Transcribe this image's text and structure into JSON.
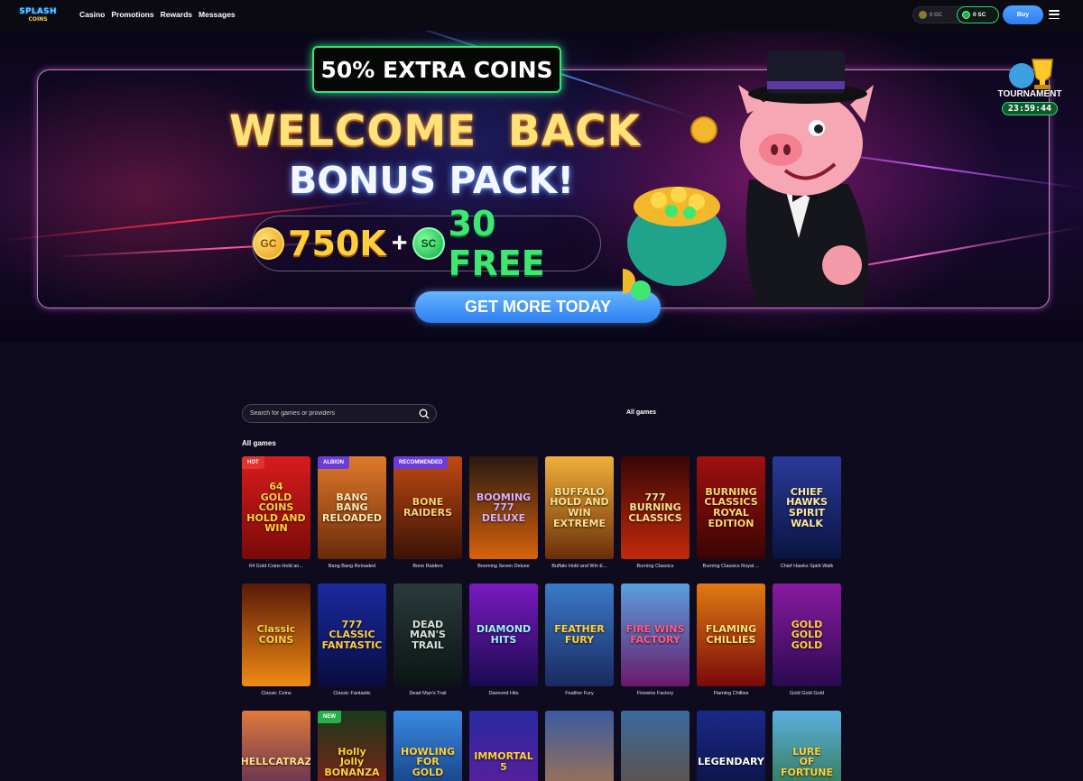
{
  "brand": {
    "line1": "SPLASH",
    "line2": "COINS"
  },
  "nav": [
    "Casino",
    "Promotions",
    "Rewards",
    "Messages"
  ],
  "wallet": {
    "gc": "0 GC",
    "sc": "0 SC",
    "buy": "Buy"
  },
  "banner": {
    "badge": "50% EXTRA COINS",
    "headline": "WELCOME  BACK",
    "subheadline": "BONUS PACK!",
    "gc_coin": "GC",
    "gc_amount": "750K",
    "plus": "+",
    "sc_coin": "SC",
    "sc_amount": "30 FREE",
    "cta": "GET MORE TODAY",
    "tournament_label": "TOURNAMENT",
    "tournament_timer": "23:59:44"
  },
  "search": {
    "placeholder": "Search for games or providers"
  },
  "filter_label": "All games",
  "section_title": "All games",
  "games": [
    {
      "caption": "64 Gold Coins Hold an...",
      "art": "64\nGOLD COINS\nHOLD AND WIN",
      "tag": "HOT",
      "tag_color": "#e2332f",
      "bg": [
        "#d81c1c",
        "#7a0a0a"
      ],
      "fg": "#ffd23a"
    },
    {
      "caption": "Bang Bang Reloaded",
      "art": "BANG BANG\nRELOADED",
      "tag": "ALBION",
      "tag_color": "#6a3cd8",
      "bg": [
        "#e07a2a",
        "#6a2a0a"
      ],
      "fg": "#ffe7b0"
    },
    {
      "caption": "Bone Raiders",
      "art": "BONE\nRAIDERS",
      "tag": "RECOMMENDED",
      "tag_color": "#6a3cd8",
      "bg": [
        "#c04a12",
        "#3a1206"
      ],
      "fg": "#ffcf6a"
    },
    {
      "caption": "Booming Seven Deluxe",
      "art": "BOOMING\n777\nDELUXE",
      "tag": "",
      "tag_color": "",
      "bg": [
        "#2a1a12",
        "#d8620a"
      ],
      "fg": "#d8b0ff"
    },
    {
      "caption": "Buffalo Hold and Win E...",
      "art": "BUFFALO\nHOLD AND WIN\nEXTREME",
      "tag": "",
      "tag_color": "",
      "bg": [
        "#f0b03a",
        "#6a2e0a"
      ],
      "fg": "#ffe08a"
    },
    {
      "caption": "Burning Classics",
      "art": "777\nBURNING CLASSICS",
      "tag": "",
      "tag_color": "",
      "bg": [
        "#3a0606",
        "#c22a0a"
      ],
      "fg": "#ffe08a"
    },
    {
      "caption": "Burning Classics Royal ...",
      "art": "BURNING\nCLASSICS\nROYAL EDITION",
      "tag": "",
      "tag_color": "",
      "bg": [
        "#a01010",
        "#3a0404"
      ],
      "fg": "#ffd86a"
    },
    {
      "caption": "Chief Hawks Spirit Walk",
      "art": "CHIEF HAWKS\nSPIRIT WALK",
      "tag": "",
      "tag_color": "",
      "bg": [
        "#2a3a9a",
        "#0a1440"
      ],
      "fg": "#ffe7a0"
    },
    {
      "caption": "Classic Coins",
      "art": "Classic\nCOINS",
      "tag": "",
      "tag_color": "",
      "bg": [
        "#5a1a0a",
        "#f08a12"
      ],
      "fg": "#ffd23a"
    },
    {
      "caption": "Classic Fantastic",
      "art": "777\nCLASSIC\nFANTASTIC",
      "tag": "",
      "tag_color": "",
      "bg": [
        "#1a2aa0",
        "#080c40"
      ],
      "fg": "#ffcf3a"
    },
    {
      "caption": "Dead Man's Trail",
      "art": "DEAD MAN'S\nTRAIL",
      "tag": "",
      "tag_color": "",
      "bg": [
        "#2a3a3a",
        "#0a1414"
      ],
      "fg": "#d8e0d8"
    },
    {
      "caption": "Diamond Hits",
      "art": "DIAMOND\nHITS",
      "tag": "",
      "tag_color": "",
      "bg": [
        "#7a1ac0",
        "#1a0a50"
      ],
      "fg": "#9af0ff"
    },
    {
      "caption": "Feather Fury",
      "art": "FEATHER\nFURY",
      "tag": "",
      "tag_color": "",
      "bg": [
        "#3a7ac8",
        "#1a2a60"
      ],
      "fg": "#ffd23a"
    },
    {
      "caption": "Firewins Factory",
      "art": "FIRE WINS\nFACTORY",
      "tag": "",
      "tag_color": "",
      "bg": [
        "#5aa0e0",
        "#6a1a6a"
      ],
      "fg": "#ff5a8a"
    },
    {
      "caption": "Flaming Chillies",
      "art": "FLAMING\nCHILLIES",
      "tag": "",
      "tag_color": "",
      "bg": [
        "#e07a12",
        "#7a0a0a"
      ],
      "fg": "#ffe27a"
    },
    {
      "caption": "Gold Gold Gold",
      "art": "GOLD GOLD GOLD",
      "tag": "",
      "tag_color": "",
      "bg": [
        "#8a1aa0",
        "#2a0a50"
      ],
      "fg": "#ffd23a"
    },
    {
      "caption": "",
      "art": "HELLCATRAZ",
      "tag": "",
      "tag_color": "",
      "bg": [
        "#e07a3a",
        "#3a1a5a"
      ],
      "fg": "#ffe08a"
    },
    {
      "caption": "",
      "art": "Holly\nJolly\nBONANZA",
      "tag": "NEW",
      "tag_color": "#27b04a",
      "bg": [
        "#1a3a1a",
        "#a01a1a"
      ],
      "fg": "#ffd23a"
    },
    {
      "caption": "",
      "art": "HOWLING\nFOR\nGOLD",
      "tag": "",
      "tag_color": "",
      "bg": [
        "#3a8ae0",
        "#0a2a6a"
      ],
      "fg": "#ffd23a"
    },
    {
      "caption": "",
      "art": "IMMORTAL\n5",
      "tag": "",
      "tag_color": "",
      "bg": [
        "#2a2aa0",
        "#6a1a9a"
      ],
      "fg": "#ffd23a"
    },
    {
      "caption": "",
      "art": "",
      "tag": "",
      "tag_color": "",
      "bg": [
        "#3a5aa0",
        "#c07a3a"
      ],
      "fg": "#ffd23a"
    },
    {
      "caption": "",
      "art": "",
      "tag": "",
      "tag_color": "",
      "bg": [
        "#3a6aa0",
        "#6a4a2a"
      ],
      "fg": "#ffd23a"
    },
    {
      "caption": "",
      "art": "LEGENDARY",
      "tag": "",
      "tag_color": "",
      "bg": [
        "#1a2a8a",
        "#080c30"
      ],
      "fg": "#ffffff"
    },
    {
      "caption": "",
      "art": "LURE\nOF\nFORTUNE",
      "tag": "",
      "tag_color": "",
      "bg": [
        "#5ab0e0",
        "#2a6a2a"
      ],
      "fg": "#ffd23a"
    }
  ]
}
